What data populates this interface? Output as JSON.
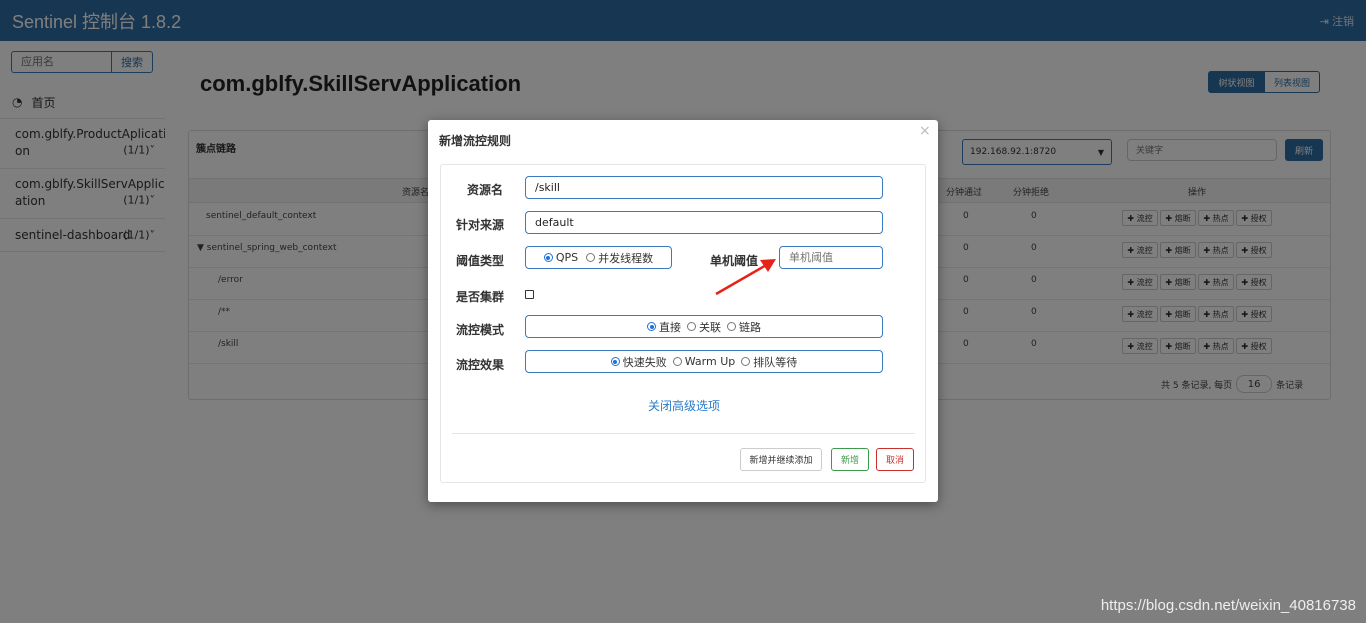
{
  "header": {
    "title": "Sentinel 控制台 1.8.2",
    "logout_label": "注销"
  },
  "sidebar": {
    "search_placeholder": "应用名",
    "search_button": "搜索",
    "home_label": "首页",
    "apps": [
      {
        "line1": "com.gblfy.ProductAplicati",
        "line2": "on",
        "count": "(1/1)"
      },
      {
        "line1": "com.gblfy.SkillServApplic",
        "line2": "ation",
        "count": "(1/1)"
      },
      {
        "line1": "sentinel-dashboard",
        "count": "(1/1)"
      }
    ]
  },
  "main": {
    "app_title": "com.gblfy.SkillServApplication",
    "tree_view": "树状视图",
    "list_view": "列表视图",
    "panel_title": "簇点链路",
    "machine_select": "192.168.92.1:8720",
    "keyword_placeholder": "关键字",
    "refresh": "刷新",
    "columns": {
      "resource": "资源名",
      "pass": "分钟通过",
      "reject": "分钟拒绝",
      "ops": "操作"
    },
    "rows": [
      {
        "name": "sentinel_default_context",
        "pass": "0",
        "reject": "0"
      },
      {
        "name": "▼ sentinel_spring_web_context",
        "pass": "0",
        "reject": "0"
      },
      {
        "name": "/error",
        "pass": "0",
        "reject": "0"
      },
      {
        "name": "/**",
        "pass": "0",
        "reject": "0"
      },
      {
        "name": "/skill",
        "pass": "0",
        "reject": "0"
      }
    ],
    "ops": {
      "flow": "✚ 流控",
      "degrade": "✚ 熔断",
      "hot": "✚ 热点",
      "auth": "✚ 授权"
    },
    "pagination": {
      "prefix": "共 5 条记录, 每页",
      "page_size": "16",
      "suffix": "条记录"
    }
  },
  "modal": {
    "title": "新增流控规则",
    "close": "×",
    "resource_label": "资源名",
    "resource_value": "/skill",
    "origin_label": "针对来源",
    "origin_value": "default",
    "threshold_type_label": "阈值类型",
    "threshold_qps": "QPS",
    "threshold_threads": "并发线程数",
    "single_threshold_label": "单机阈值",
    "single_threshold_placeholder": "单机阈值",
    "cluster_label": "是否集群",
    "mode_label": "流控模式",
    "mode_direct": "直接",
    "mode_related": "关联",
    "mode_chain": "链路",
    "effect_label": "流控效果",
    "effect_fast": "快速失败",
    "effect_warmup": "Warm Up",
    "effect_queue": "排队等待",
    "advanced_link": "关闭高级选项",
    "add_continue": "新增并继续添加",
    "add": "新增",
    "cancel": "取消"
  },
  "watermark": "https://blog.csdn.net/weixin_40816738"
}
